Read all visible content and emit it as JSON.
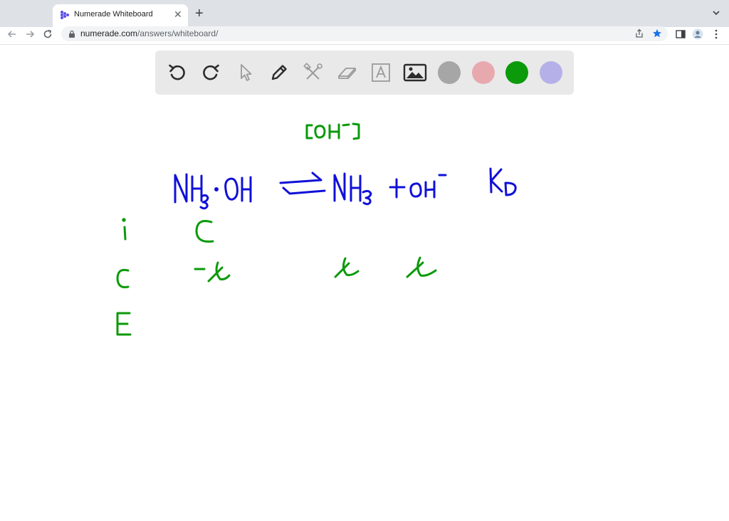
{
  "browser": {
    "tab_title": "Numerade Whiteboard",
    "url_domain": "numerade.com",
    "url_path": "/answers/whiteboard/",
    "favicon_color": "#5a50e6"
  },
  "whiteboard_toolbar": {
    "tools": [
      "undo-icon",
      "redo-icon",
      "pointer-icon",
      "pen-icon",
      "tools-icon",
      "eraser-icon",
      "text-icon",
      "image-icon"
    ],
    "colors": [
      "#a6a6a6",
      "#e8a9ae",
      "#0a9a0a",
      "#b5b1e8"
    ],
    "selected_color": "#0a9a0a"
  },
  "drawing": {
    "ink_colors": {
      "blue": "#1010d8",
      "green": "#0a9a0a"
    },
    "note": "[OH⁻]",
    "equation_left": "NH₃·OH",
    "arrow": "⇌",
    "equation_right_1": "NH₃",
    "plus": "+",
    "equation_right_2": "OH⁻",
    "constant": "Kb",
    "ice_rows": [
      {
        "label": "i",
        "col1": "C",
        "col2": "",
        "col3": ""
      },
      {
        "label": "c",
        "col1": "-x",
        "col2": "x",
        "col3": "x"
      },
      {
        "label": "E",
        "col1": "",
        "col2": "",
        "col3": ""
      }
    ]
  }
}
